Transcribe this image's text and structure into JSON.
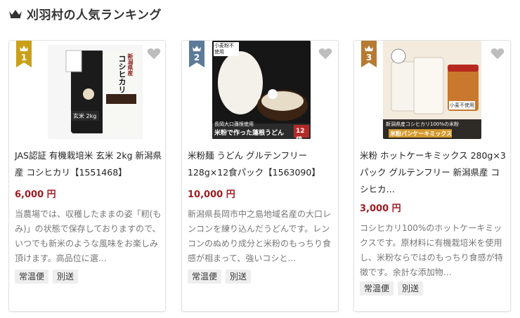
{
  "header": {
    "title": "刈羽村の人気ランキング",
    "icon": "crown-icon"
  },
  "colors": {
    "rank1": "#c9a019",
    "rank2": "#5d7a99",
    "rank3": "#b77a32",
    "price": "#9f1c22"
  },
  "products": [
    {
      "rank": "1",
      "name": "JAS認証 有機栽培米 玄米 2kg 新潟県産 コシヒカリ【1551468】",
      "price": "6,000 円",
      "description": "当農場では、収穫したままの姿「籾(もみ)」の状態で保存しておりますので、いつでも新米のような風味をお楽しみ頂けます。高品位に選…",
      "tags": [
        "常温便",
        "別送"
      ],
      "image_text": {
        "top": "新潟県産",
        "main": "コシヒカリ",
        "badge": "有機JAS認証米",
        "label": "玄米 2kg"
      }
    },
    {
      "rank": "2",
      "name": "米粉麺 うどん グルテンフリー 128g×12食パック【1563090】",
      "price": "10,000 円",
      "description": "新潟県長岡市中之島地域名産の大口レンコンを練り込んだうどんです。レンコンのぬめり成分と米粉のもっちり食感が相まって、強いコシと…",
      "tags": [
        "常温便",
        "別送"
      ],
      "image_text": {
        "badge": "小麦粉不使用",
        "sub": "長岡大口蓮根使用",
        "main": "米粉で作った蓮根うどん",
        "pack": "12袋"
      }
    },
    {
      "rank": "3",
      "name": "米粉 ホットケーキミックス 280g×3パック グルテンフリー 新潟県産 コシヒカ…",
      "price": "3,000 円",
      "description": "コシヒカリ100%のホットケーキミックスです。原材料に有機栽培米を使用し、米粉ならではのもっちり食感が特徴です。余計な添加物…",
      "tags": [
        "常温便",
        "別送"
      ],
      "image_text": {
        "badge": "小麦不使用",
        "sub": "新潟県産コシヒカリ100%の米粉",
        "main": "米粉パンケーキミックス"
      }
    }
  ]
}
